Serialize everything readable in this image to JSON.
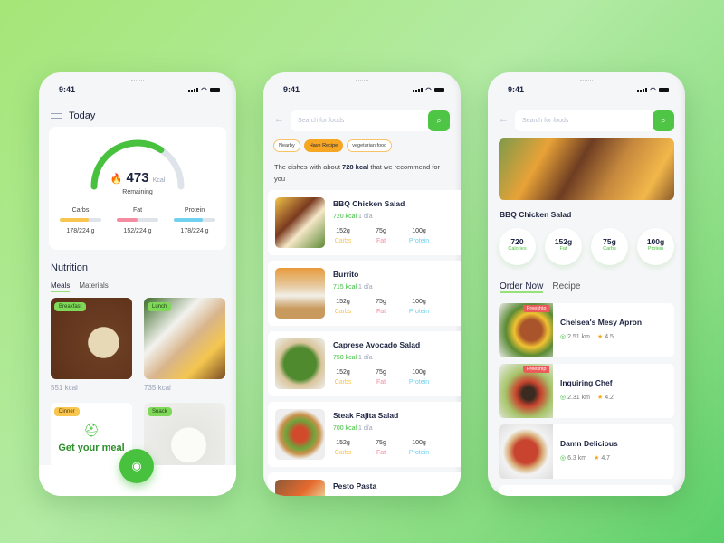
{
  "colors": {
    "accent": "#4fc545",
    "carbs": "#f8c54e",
    "fat": "#f58ba0",
    "protein": "#6fd0f0",
    "freeship": "#ec5b5b",
    "chip_active": "#f5a623"
  },
  "status": {
    "time": "9:41"
  },
  "screen1": {
    "title": "Today",
    "gauge": {
      "value": 473,
      "unit": "Kcal",
      "label": "Remaining",
      "progress": 0.68
    },
    "macros": [
      {
        "name": "Carbs",
        "value": "178/224 g",
        "fraction": 0.7
      },
      {
        "name": "Fat",
        "value": "152/224 g",
        "fraction": 0.5
      },
      {
        "name": "Protein",
        "value": "178/224 g",
        "fraction": 0.7
      }
    ],
    "section": "Nutrition",
    "tabs": [
      "Meals",
      "Materials"
    ],
    "meals": [
      {
        "tag": "Breakfast",
        "kcal": "551 kcal"
      },
      {
        "tag": "Lunch",
        "kcal": "735 kcal"
      },
      {
        "tag": "Dinner",
        "cta": "Get your meal"
      },
      {
        "tag": "Snack"
      }
    ],
    "camera_icon": "camera-icon"
  },
  "screen2": {
    "search_placeholder": "Search for foods",
    "chips": [
      "Nearby",
      "Have Recipe",
      "vegetarian food"
    ],
    "active_chip": "Have Recipe",
    "rec_prefix": "The dishes with about ",
    "rec_kcal": "728 kcal",
    "rec_suffix": " that we recommend for you",
    "foods": [
      {
        "name": "BBQ Chicken Salad",
        "kcal": "720 kcal",
        "serving": "1 dĩa",
        "carbs": "152g",
        "fat": "75g",
        "protein": "100g"
      },
      {
        "name": "Burrito",
        "kcal": "715 kcal",
        "serving": "1 dĩa",
        "carbs": "152g",
        "fat": "75g",
        "protein": "100g"
      },
      {
        "name": "Caprese Avocado Salad",
        "kcal": "750 kcal",
        "serving": "1 dĩa",
        "carbs": "152g",
        "fat": "75g",
        "protein": "100g"
      },
      {
        "name": "Steak Fajita Salad",
        "kcal": "700 kcal",
        "serving": "1 dĩa",
        "carbs": "152g",
        "fat": "75g",
        "protein": "100g"
      },
      {
        "name": "Pesto Pasta"
      }
    ],
    "macro_labels": {
      "carbs": "Carbs",
      "fat": "Fat",
      "protein": "Protein"
    }
  },
  "screen3": {
    "search_placeholder": "Search for foods",
    "dish": "BBQ Chicken Salad",
    "stats": [
      {
        "value": "720",
        "label": "Calories"
      },
      {
        "value": "152g",
        "label": "Fat"
      },
      {
        "value": "75g",
        "label": "Carbs"
      },
      {
        "value": "100g",
        "label": "Protein"
      }
    ],
    "tabs": [
      "Order Now",
      "Recipe"
    ],
    "restaurants": [
      {
        "name": "Chelsea's Mesy Apron",
        "distance": "2.51 km",
        "rating": "4.5",
        "badge": "Freeship"
      },
      {
        "name": "Inquiring Chef",
        "distance": "2.31 km",
        "rating": "4.2",
        "badge": "Freeship"
      },
      {
        "name": "Damn Delicious",
        "distance": "6.3 km",
        "rating": "4.7"
      }
    ]
  }
}
